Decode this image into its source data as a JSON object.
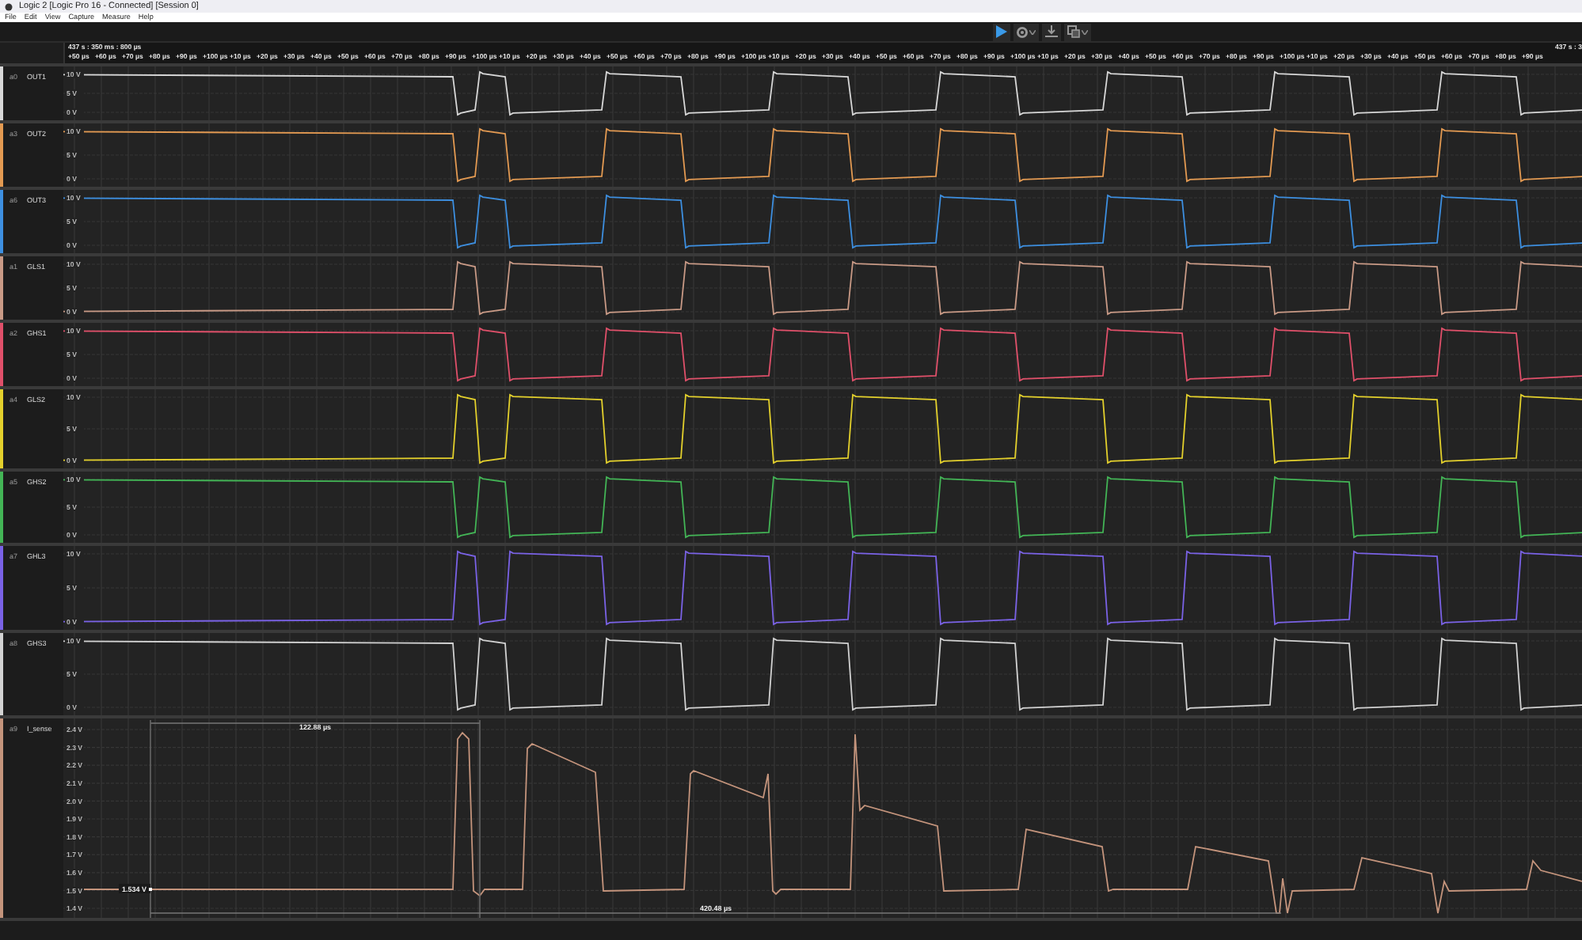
{
  "window": {
    "title": "Logic 2 [Logic Pro 16 - Connected] [Session 0]"
  },
  "menu": [
    "File",
    "Edit",
    "View",
    "Capture",
    "Measure",
    "Help"
  ],
  "ruler": {
    "timestamp": "437 s : 350 ms : 800 µs",
    "timestamp_right": "437 s : 3",
    "ticks": [
      "+50 µs",
      "+60 µs",
      "+70 µs",
      "+80 µs",
      "+90 µs",
      "+100 µs",
      "+10 µs",
      "+20 µs",
      "+30 µs",
      "+40 µs",
      "+50 µs",
      "+60 µs",
      "+70 µs",
      "+80 µs",
      "+90 µs",
      "+100 µs",
      "+10 µs",
      "+20 µs",
      "+30 µs",
      "+40 µs",
      "+50 µs",
      "+60 µs",
      "+70 µs",
      "+80 µs",
      "+90 µs",
      "+100 µs",
      "+10 µs",
      "+20 µs",
      "+30 µs",
      "+40 µs",
      "+50 µs",
      "+60 µs",
      "+70 µs",
      "+80 µs",
      "+90 µs",
      "+100 µs",
      "+10 µs",
      "+20 µs",
      "+30 µs",
      "+40 µs",
      "+50 µs",
      "+60 µs",
      "+70 µs",
      "+80 µs",
      "+90 µs",
      "+100 µs",
      "+10 µs",
      "+20 µs",
      "+30 µs",
      "+40 µs",
      "+50 µs",
      "+60 µs",
      "+70 µs",
      "+80 µs",
      "+90 µs"
    ]
  },
  "channels": [
    {
      "index": "a0",
      "name": "OUT1",
      "color": "#d8d8d8",
      "kind": "high-idle",
      "scale": [
        "10 V",
        "5 V",
        "0 V"
      ]
    },
    {
      "index": "a3",
      "name": "OUT2",
      "color": "#e39a52",
      "kind": "high-idle",
      "scale": [
        "10 V",
        "5 V",
        "0 V"
      ]
    },
    {
      "index": "a6",
      "name": "OUT3",
      "color": "#3d8fe0",
      "kind": "high-idle",
      "scale": [
        "10 V",
        "5 V",
        "0 V"
      ]
    },
    {
      "index": "a1",
      "name": "GLS1",
      "color": "#c99a86",
      "kind": "low-idle",
      "scale": [
        "10 V",
        "5 V",
        "0 V"
      ]
    },
    {
      "index": "a2",
      "name": "GHS1",
      "color": "#e0506a",
      "kind": "high-idle",
      "scale": [
        "10 V",
        "5 V",
        "0 V"
      ]
    },
    {
      "index": "a4",
      "name": "GLS2",
      "color": "#e3d02c",
      "kind": "low-idle",
      "scale": [
        "10 V",
        "5 V",
        "0 V"
      ]
    },
    {
      "index": "a5",
      "name": "GHS2",
      "color": "#43b556",
      "kind": "high-idle",
      "scale": [
        "10 V",
        "5 V",
        "0 V"
      ]
    },
    {
      "index": "a7",
      "name": "GHL3",
      "color": "#7a62e6",
      "kind": "low-idle",
      "scale": [
        "10 V",
        "5 V",
        "0 V"
      ]
    },
    {
      "index": "a8",
      "name": "GHS3",
      "color": "#d2d2d2",
      "kind": "high-idle",
      "scale": [
        "10 V",
        "5 V",
        "0 V"
      ]
    },
    {
      "index": "a9",
      "name": "I_sense",
      "color": "#c4947c",
      "kind": "analog",
      "scale": [
        "2.4 V",
        "2.3 V",
        "2.2 V",
        "2.1 V",
        "2.0 V",
        "1.9 V",
        "1.8 V",
        "1.7 V",
        "1.6 V",
        "1.5 V",
        "1.4 V"
      ],
      "measurements": [
        {
          "kind": "top-span",
          "label": "122.88 µs"
        },
        {
          "kind": "value",
          "label": "1.534 V"
        },
        {
          "kind": "bottom-span",
          "label": "420.48 µs"
        }
      ]
    }
  ]
}
